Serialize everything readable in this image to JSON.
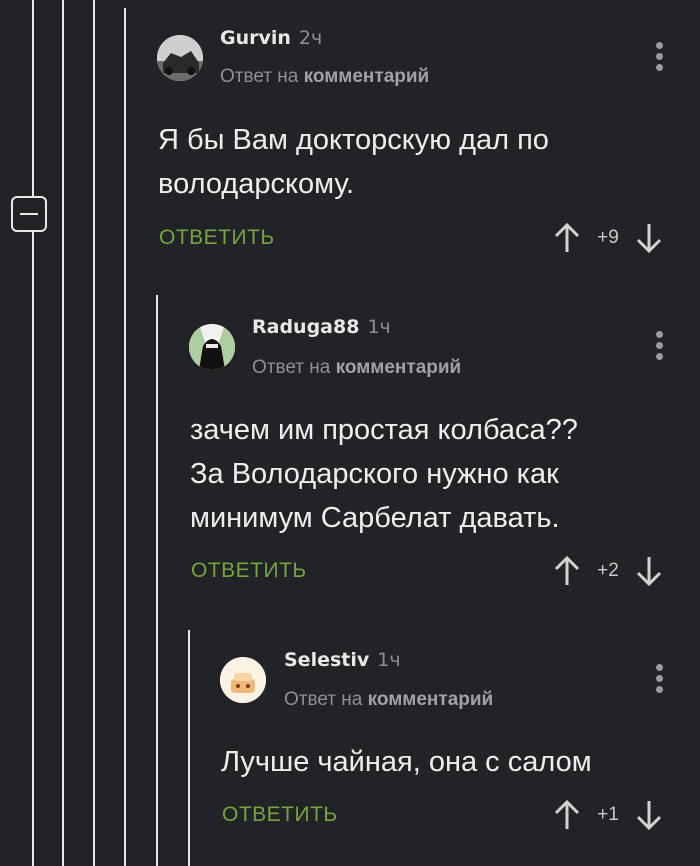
{
  "comments": [
    {
      "author": "Gurvin",
      "time": "2ч",
      "reply_prefix": "Ответ на",
      "reply_target": "комментарий",
      "text": "Я бы Вам докторскую дал по\nволодарскому.",
      "reply_label": "ОТВЕТИТЬ",
      "score": "+9"
    },
    {
      "author": "Raduga88",
      "time": "1ч",
      "reply_prefix": "Ответ на",
      "reply_target": "комментарий",
      "text": "зачем им простая колбаса??\nЗа Володарского нужно как\nминимум Сарбелат давать.",
      "reply_label": "ОТВЕТИТЬ",
      "score": "+2"
    },
    {
      "author": "Selestiv",
      "time": "1ч",
      "reply_prefix": "Ответ на",
      "reply_target": "комментарий",
      "text": "Лучше чайная, она с салом",
      "reply_label": "ОТВЕТИТЬ",
      "score": "+1"
    }
  ],
  "colors": {
    "background": "#212327",
    "reply_accent": "#76a53f",
    "thread_line": "#e8e8e8"
  }
}
